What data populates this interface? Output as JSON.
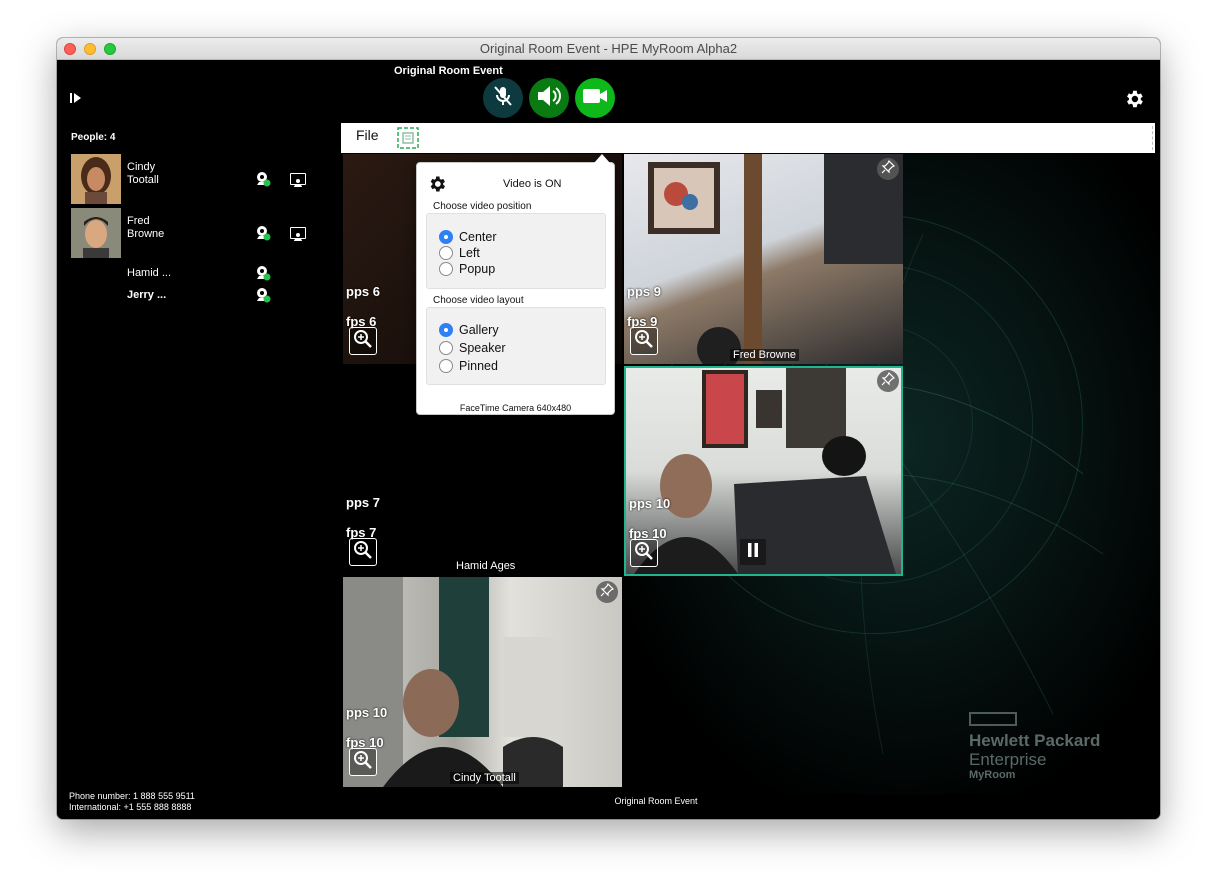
{
  "window": {
    "title": "Original Room Event - HPE MyRoom Alpha2"
  },
  "header": {
    "event_name": "Original Room Event"
  },
  "sidebar": {
    "people_count": "People: 4",
    "people": [
      {
        "first": "Cindy",
        "last": "Tootall"
      },
      {
        "first": "Fred",
        "last": "Browne"
      },
      {
        "name": "Hamid ..."
      },
      {
        "name": "Jerry ..."
      }
    ],
    "phone_number": "Phone number: 1 888 555 9511",
    "international": "International:  +1 555 888 8888"
  },
  "menubar": {
    "file": "File"
  },
  "popup": {
    "title": "Video is ON",
    "position_label": "Choose video position",
    "positions": [
      "Center",
      "Left",
      "Popup"
    ],
    "position_selected": "Center",
    "layout_label": "Choose video layout",
    "layouts": [
      "Gallery",
      "Speaker",
      "Pinned"
    ],
    "layout_selected": "Gallery",
    "camera": "FaceTime Camera 640x480"
  },
  "tiles": [
    {
      "pps": "pps 6",
      "fps": "fps 6",
      "name": ""
    },
    {
      "pps": "pps 9",
      "fps": "fps 9",
      "name": "Fred Browne"
    },
    {
      "pps": "pps 7",
      "fps": "fps 7",
      "name": "Hamid Ages"
    },
    {
      "pps": "pps 10",
      "fps": "fps 10",
      "name": ""
    },
    {
      "pps": "pps 10",
      "fps": "fps 10",
      "name": "Cindy Tootall"
    }
  ],
  "footer": {
    "event_name": "Original Room Event"
  },
  "branding": {
    "line1": "Hewlett Packard",
    "line2": "Enterprise",
    "line3": "MyRoom"
  },
  "colors": {
    "mic_off": "#0d3a3f",
    "speaker_on": "#0a7a12",
    "camera_on": "#0fb81a",
    "active_tile_border": "#1fb58f",
    "radio_selected": "#2f7ff5"
  }
}
